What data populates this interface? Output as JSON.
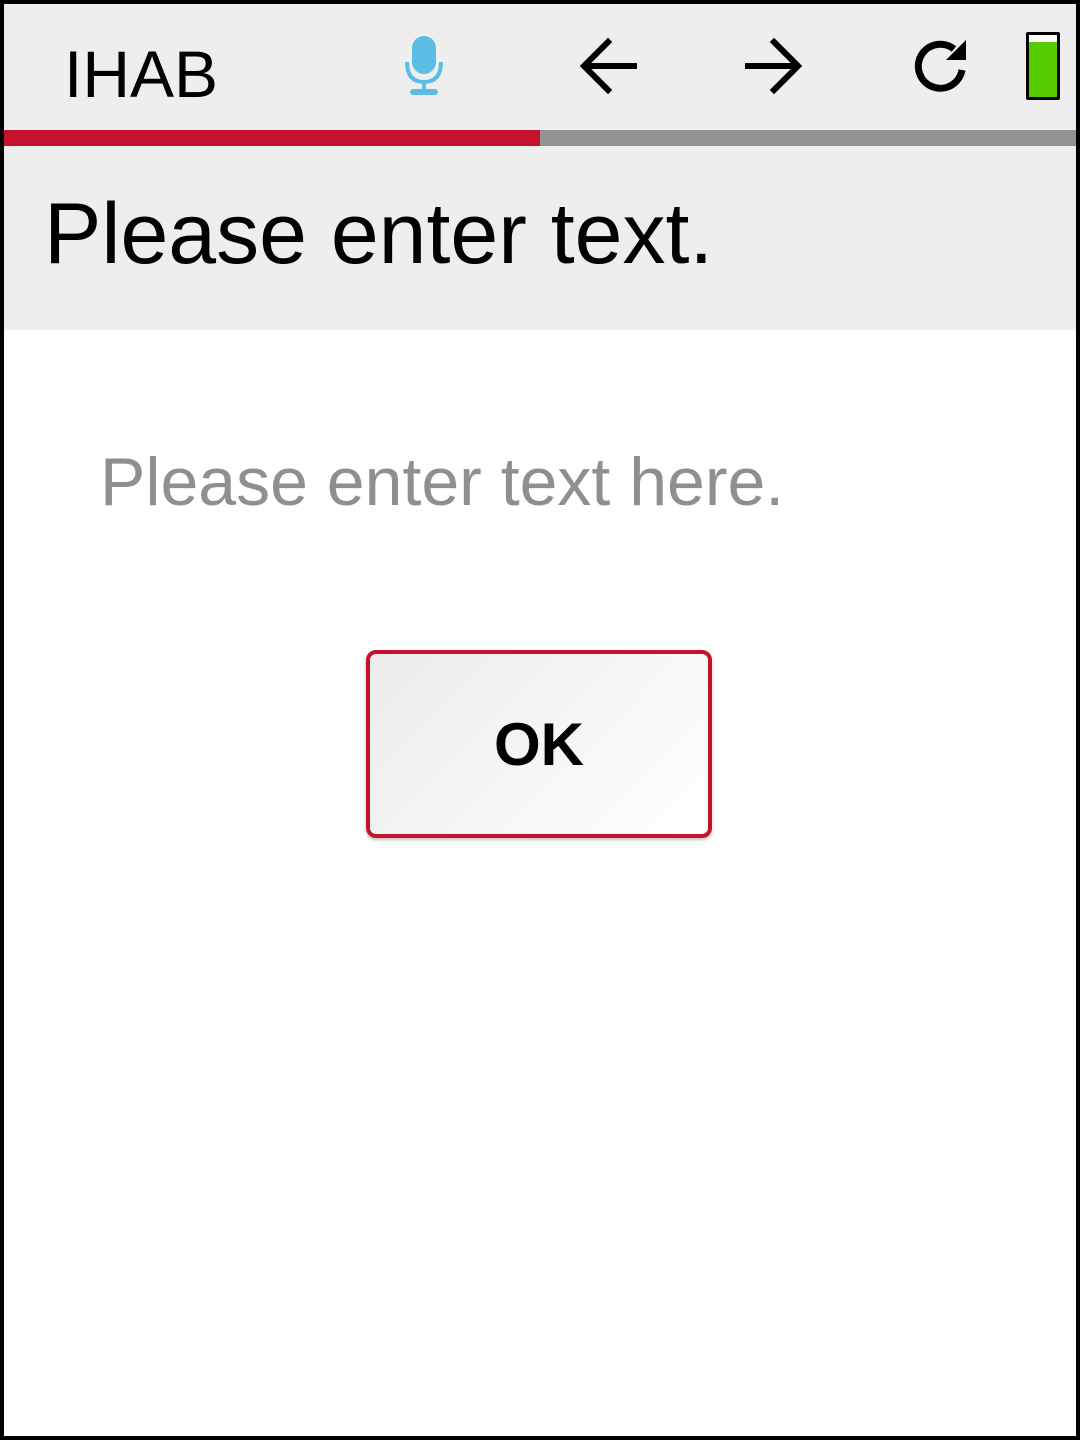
{
  "header": {
    "app_title": "IHAB",
    "icons": {
      "mic": "microphone-icon",
      "back": "arrow-left-icon",
      "forward": "arrow-right-icon",
      "refresh": "refresh-icon",
      "battery": "battery-icon"
    },
    "battery_level": 0.88,
    "battery_color": "#55cc00",
    "mic_color": "#5bbde4"
  },
  "progress": {
    "fraction": 0.5,
    "fill_color": "#c4122f",
    "track_color": "#939393"
  },
  "question": {
    "text": "Please enter text."
  },
  "input": {
    "value": "",
    "placeholder": "Please enter text here."
  },
  "ok_button": {
    "label": "OK",
    "border_color": "#c4122f"
  }
}
